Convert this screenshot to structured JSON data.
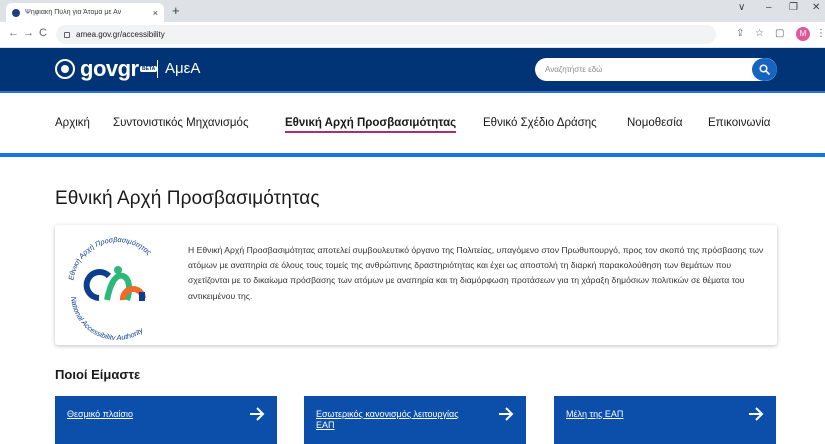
{
  "browser": {
    "tab_title": "Ψηφιακή Πύλη για Άτομα με Αν",
    "tab_close": "×",
    "new_tab": "+",
    "url": "amea.gov.gr/accessibility",
    "avatar_letter": "M",
    "controls": {
      "minimize": "–",
      "restore": "❐",
      "close": "✕",
      "dropdown": "∨"
    }
  },
  "header": {
    "logo_text": "govgr",
    "beta_label": "BETA",
    "site_name": "ΑμεΑ",
    "search_placeholder": "Αναζητήστε εδώ",
    "brand_color": "#003476"
  },
  "nav": {
    "items": [
      {
        "label": "Αρχική"
      },
      {
        "label": "Συντονιστικός Μηχανισμός"
      },
      {
        "label": "Εθνική Αρχή Προσβασιμότητας",
        "active": true
      },
      {
        "label": "Εθνικό Σχέδιο Δράσης"
      },
      {
        "label": "Νομοθεσία"
      },
      {
        "label": "Επικοινωνία"
      }
    ]
  },
  "page": {
    "title": "Εθνική Αρχή Προσβασιμότητας",
    "description": "Η Εθνική Αρχή Προσβασιμότητας αποτελεί συμβουλευτικό όργανο της Πολιτείας, υπαγόμενο στον Πρωθυπουργό, προς τον σκοπό της πρόσβασης των ατόμων με αναπηρία σε όλους τους τομείς της ανθρώπινης δραστηριότητας και έχει ως αποστολή τη διαρκή παρακολούθηση των θεμάτων που σχετίζονται με το δικαίωμα πρόσβασης των ατόμων με αναπηρία και τη διαμόρφωση προτάσεων για τη χάραξη δημόσιων πολιτικών σε θέματα του αντικειμένου της.",
    "logo": {
      "top_text": "Εθνική Αρχή Προσβασιμότητας",
      "bottom_text": "National Accessibility Authority"
    },
    "section_title": "Ποιοί Είμαστε",
    "tiles": [
      {
        "label": "Θεσμικό πλαίσιο"
      },
      {
        "label": "Εσωτερικός κανονισμός λειτουργίας ΕΑΠ"
      },
      {
        "label": "Μέλη της ΕΑΠ"
      }
    ],
    "tile_color": "#0b4faa",
    "accent_color": "#b5296d"
  }
}
